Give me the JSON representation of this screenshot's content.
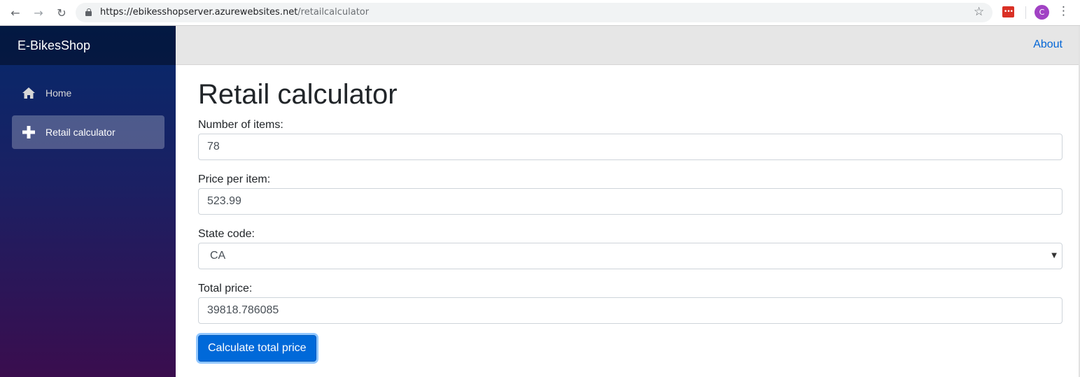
{
  "browser": {
    "url_host": "https://ebikesshopserver.azurewebsites.net",
    "url_path": "/retailcalculator",
    "profile_initial": "C",
    "extension_glyph": "•••"
  },
  "sidebar": {
    "brand": "E-BikesShop",
    "items": [
      {
        "label": "Home",
        "icon": "home-icon",
        "active": false
      },
      {
        "label": "Retail calculator",
        "icon": "plus-icon",
        "active": true
      }
    ]
  },
  "topbar": {
    "about_label": "About"
  },
  "page": {
    "title": "Retail calculator",
    "fields": {
      "items_label": "Number of items:",
      "items_value": "78",
      "price_label": "Price per item:",
      "price_value": "523.99",
      "state_label": "State code:",
      "state_value": "CA",
      "total_label": "Total price:",
      "total_value": "39818.786085"
    },
    "calculate_label": "Calculate total price"
  },
  "colors": {
    "sidebar_top": "#05296b",
    "sidebar_bottom": "#3a0d4e",
    "primary_button": "#0069d9",
    "link": "#0366d6"
  }
}
